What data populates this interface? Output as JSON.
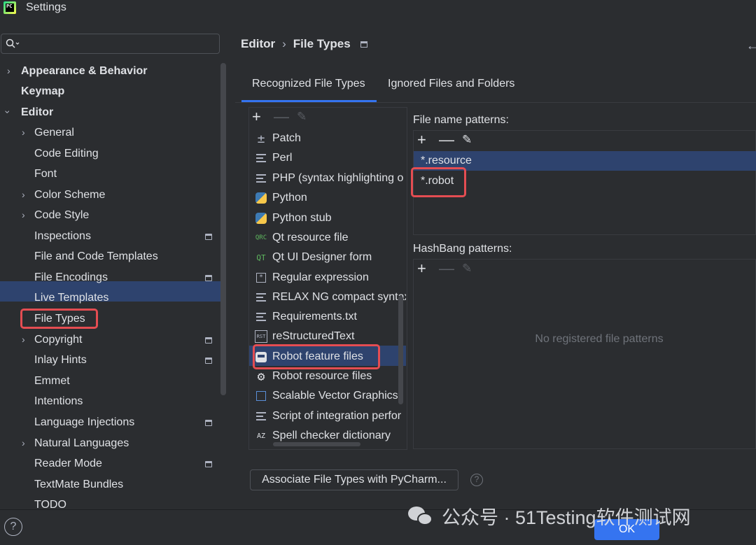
{
  "window": {
    "title": "Settings",
    "logo_text": "PC"
  },
  "search": {
    "value": "",
    "placeholder": ""
  },
  "sidebar": {
    "items": [
      {
        "label": "Appearance & Behavior"
      },
      {
        "label": "Keymap"
      },
      {
        "label": "Editor"
      },
      {
        "label": "General"
      },
      {
        "label": "Code Editing"
      },
      {
        "label": "Font"
      },
      {
        "label": "Color Scheme"
      },
      {
        "label": "Code Style"
      },
      {
        "label": "Inspections"
      },
      {
        "label": "File and Code Templates"
      },
      {
        "label": "File Encodings"
      },
      {
        "label": "Live Templates"
      },
      {
        "label": "File Types"
      },
      {
        "label": "Copyright"
      },
      {
        "label": "Inlay Hints"
      },
      {
        "label": "Emmet"
      },
      {
        "label": "Intentions"
      },
      {
        "label": "Language Injections"
      },
      {
        "label": "Natural Languages"
      },
      {
        "label": "Reader Mode"
      },
      {
        "label": "TextMate Bundles"
      },
      {
        "label": "TODO"
      }
    ],
    "selected": "File Types"
  },
  "breadcrumb": {
    "parent": "Editor",
    "separator": "›",
    "current": "File Types"
  },
  "tabs": [
    {
      "label": "Recognized File Types",
      "active": true
    },
    {
      "label": "Ignored Files and Folders",
      "active": false
    }
  ],
  "file_types": {
    "items": [
      {
        "label": "Patch",
        "icon": "patch-icon"
      },
      {
        "label": "Perl",
        "icon": "text-lines-icon"
      },
      {
        "label": "PHP (syntax highlighting o",
        "icon": "text-lines-icon"
      },
      {
        "label": "Python",
        "icon": "python-icon"
      },
      {
        "label": "Python stub",
        "icon": "python-icon"
      },
      {
        "label": "Qt resource file",
        "icon": "qrc-icon",
        "icon_text": "QRC"
      },
      {
        "label": "Qt UI Designer form",
        "icon": "qt-icon",
        "icon_text": "QT"
      },
      {
        "label": "Regular expression",
        "icon": "regex-icon"
      },
      {
        "label": "RELAX NG compact syntax",
        "icon": "text-lines-icon"
      },
      {
        "label": "Requirements.txt",
        "icon": "text-lines-icon"
      },
      {
        "label": "reStructuredText",
        "icon": "rst-icon",
        "icon_text": "RST"
      },
      {
        "label": "Robot feature files",
        "icon": "robot-icon"
      },
      {
        "label": "Robot resource files",
        "icon": "gear-icon"
      },
      {
        "label": "Scalable Vector Graphics",
        "icon": "svg-icon"
      },
      {
        "label": "Script of integration perfor",
        "icon": "text-lines-icon"
      },
      {
        "label": "Spell checker dictionary",
        "icon": "az-icon",
        "icon_text": "AZ"
      }
    ],
    "selected": "Robot feature files"
  },
  "file_name_patterns": {
    "label": "File name patterns:",
    "items": [
      "*.resource",
      "*.robot"
    ],
    "selected": "*.resource"
  },
  "hashbang_patterns": {
    "label": "HashBang patterns:",
    "empty_text": "No registered file patterns"
  },
  "buttons": {
    "associate": "Associate File Types with PyCharm...",
    "help": "?",
    "ok": "OK"
  },
  "watermark": {
    "text": "公众号 · 51Testing软件测试网"
  },
  "colors": {
    "accent": "#3574f0",
    "selection": "#2e436e",
    "highlight_box": "#e44d52",
    "background": "#2b2d30"
  }
}
